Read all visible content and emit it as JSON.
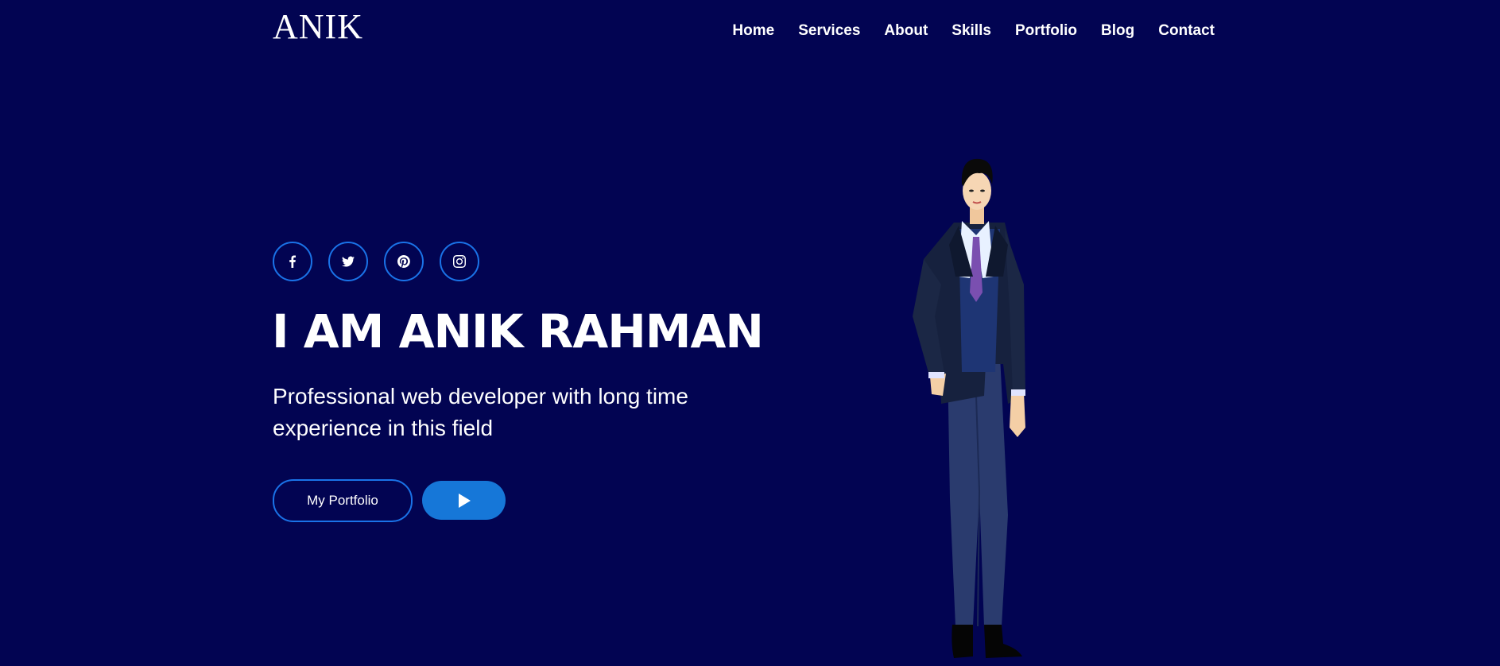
{
  "header": {
    "logo": "ANIK",
    "nav": [
      "Home",
      "Services",
      "About",
      "Skills",
      "Portfolio",
      "Blog",
      "Contact"
    ]
  },
  "hero": {
    "socials": [
      "facebook-icon",
      "twitter-icon",
      "pinterest-icon",
      "instagram-icon"
    ],
    "headline": "I AM ANIK RAHMAN",
    "tagline": "Professional web developer with long time experience in this field",
    "portfolio_button": "My Portfolio",
    "play_button_icon": "play-icon"
  },
  "colors": {
    "background": "#020452",
    "accent": "#1a73e8",
    "play_button": "#1677d8"
  }
}
